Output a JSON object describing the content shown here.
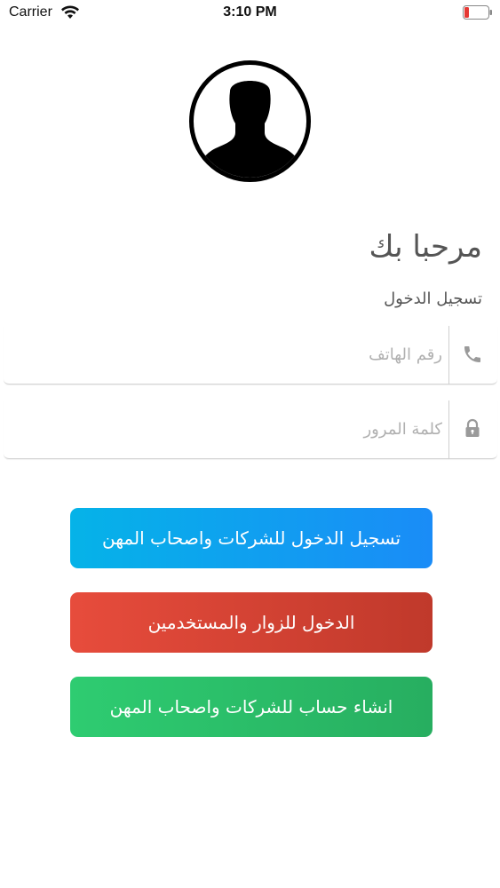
{
  "status_bar": {
    "carrier": "Carrier",
    "time": "3:10 PM",
    "battery_color": "#e53935"
  },
  "header": {
    "welcome_title": "مرحبا بك",
    "login_subtitle": "تسجيل الدخول"
  },
  "form": {
    "phone_placeholder": "رقم الهاتف",
    "phone_value": "",
    "password_placeholder": "كلمة المرور",
    "password_value": ""
  },
  "buttons": {
    "business_login": "تسجيل الدخول للشركات واصحاب المهن",
    "visitor_login": "الدخول للزوار والمستخدمين",
    "create_account": "انشاء حساب للشركات واصحاب المهن"
  },
  "colors": {
    "business_login": "#1a8cf7",
    "visitor_login": "#e74c3c",
    "create_account": "#2ecc71"
  },
  "icons": {
    "avatar": "person-silhouette-icon",
    "phone": "phone-icon",
    "password": "lock-icon",
    "wifi": "wifi-icon",
    "battery": "battery-icon"
  }
}
